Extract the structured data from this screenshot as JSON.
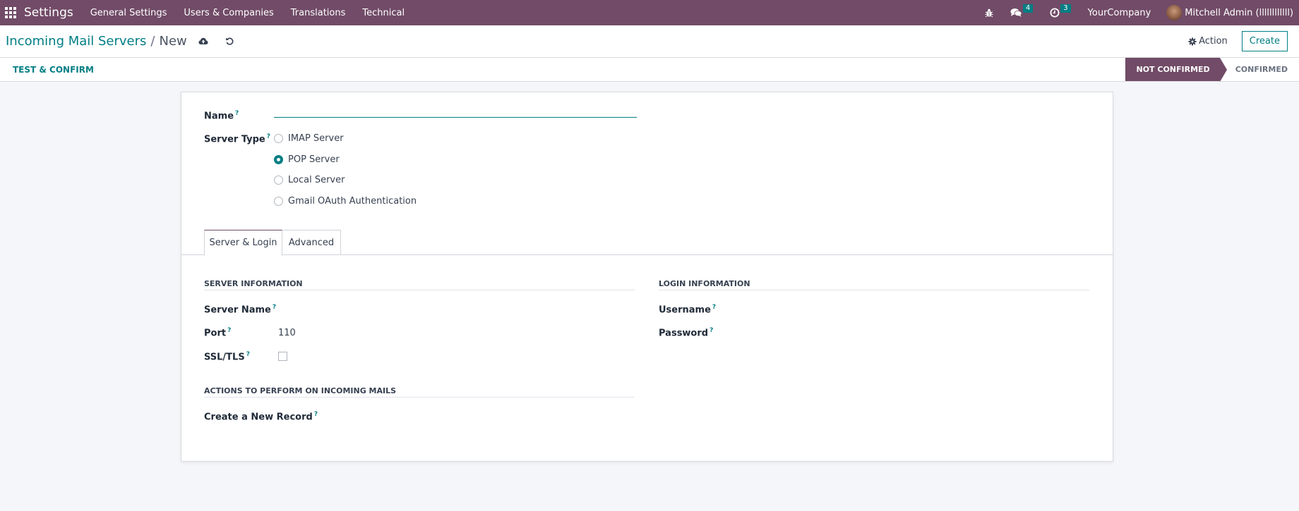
{
  "navbar": {
    "brand": "Settings",
    "menus": [
      "General Settings",
      "Users & Companies",
      "Translations",
      "Technical"
    ],
    "messages_count": "4",
    "activities_count": "3",
    "company": "YourCompany",
    "user": "Mitchell Admin (llllllllllll)"
  },
  "control": {
    "breadcrumb_parent": "Incoming Mail Servers",
    "breadcrumb_sep": "/",
    "breadcrumb_current": "New",
    "action_label": "Action",
    "create_label": "Create"
  },
  "statusbar": {
    "test_button": "TEST & CONFIRM",
    "stages": [
      {
        "label": "NOT CONFIRMED",
        "active": true
      },
      {
        "label": "CONFIRMED",
        "active": false
      }
    ]
  },
  "form": {
    "name_label": "Name",
    "name_value": "",
    "help_mark": "?",
    "server_type_label": "Server Type",
    "server_type_options": [
      "IMAP Server",
      "POP Server",
      "Local Server",
      "Gmail OAuth Authentication"
    ],
    "server_type_selected": "POP Server",
    "tabs": [
      "Server & Login",
      "Advanced"
    ],
    "active_tab": "Server & Login",
    "server_info_title": "SERVER INFORMATION",
    "server_name_label": "Server Name",
    "server_name_value": "",
    "port_label": "Port",
    "port_value": "110",
    "ssl_label": "SSL/TLS",
    "ssl_checked": false,
    "login_info_title": "LOGIN INFORMATION",
    "username_label": "Username",
    "password_label": "Password",
    "actions_title": "ACTIONS TO PERFORM ON INCOMING MAILS",
    "create_record_label": "Create a New Record"
  },
  "colors": {
    "brand": "#714b67",
    "accent": "#017e84"
  }
}
